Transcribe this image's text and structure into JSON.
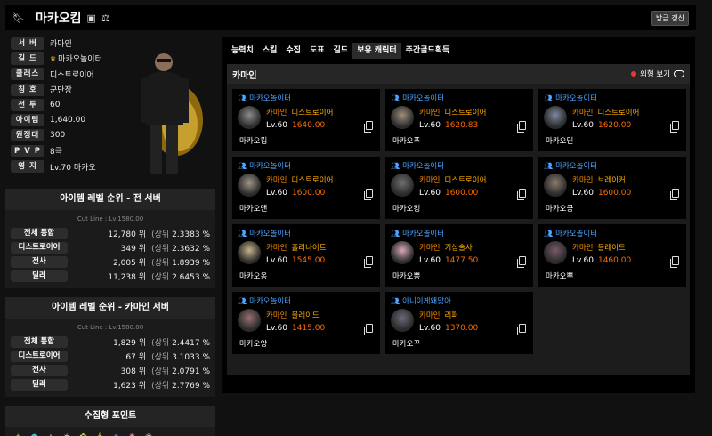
{
  "header": {
    "name": "마카오킴",
    "refresh_label": "방금 갱신"
  },
  "profile": [
    {
      "label": "서 버",
      "value": "카마인"
    },
    {
      "label": "길 드",
      "value": "마카오놀이터",
      "crown": true
    },
    {
      "label": "클래스",
      "value": "디스트로이어"
    },
    {
      "label": "칭 호",
      "value": "군단장"
    },
    {
      "label": "전 투",
      "value": "60"
    },
    {
      "label": "아이템",
      "value": "1,640.00"
    },
    {
      "label": "원정대",
      "value": "300"
    },
    {
      "label": "P V P",
      "value": "8극"
    },
    {
      "label": "영 지",
      "value": "Lv.70 마카오"
    }
  ],
  "rank_all": {
    "title": "아이템 레벨 순위 - 전 서버",
    "cut": "Cut Line : Lv.1580.00",
    "rows": [
      {
        "label": "전체 통합",
        "rank": "12,780 위",
        "pct": "2.3383 %"
      },
      {
        "label": "디스트로이어",
        "rank": "349 위",
        "pct": "2.3632 %"
      },
      {
        "label": "전사",
        "rank": "2,005 위",
        "pct": "1.8939 %"
      },
      {
        "label": "딜러",
        "rank": "11,238 위",
        "pct": "2.6453 %"
      }
    ]
  },
  "rank_server": {
    "title": "아이템 레벨 순위 - 카마인 서버",
    "cut": "Cut Line : Lv.1580.00",
    "rows": [
      {
        "label": "전체 통합",
        "rank": "1,829 위",
        "pct": "2.4417 %"
      },
      {
        "label": "디스트로이어",
        "rank": "67 위",
        "pct": "3.1033 %"
      },
      {
        "label": "전사",
        "rank": "308 위",
        "pct": "2.0791 %"
      },
      {
        "label": "딜러",
        "rank": "1,623 위",
        "pct": "2.7769 %"
      }
    ]
  },
  "upper_label": "(상위",
  "collect_title": "수집형 포인트",
  "tabs": [
    "능력치",
    "스킬",
    "수집",
    "도표",
    "길드",
    "보유 캐릭터",
    "주간골드획득"
  ],
  "active_tab": 5,
  "panel": {
    "title": "카마인",
    "toggle_label": "외형 보기"
  },
  "characters": [
    {
      "guild": "마카오놀이터",
      "server": "카마인",
      "class": "디스트로이어",
      "lv": "Lv.60",
      "ilvl": "1640.00",
      "name": "마카오킴"
    },
    {
      "guild": "마카오놀이터",
      "server": "카마인",
      "class": "디스트로이어",
      "lv": "Lv.60",
      "ilvl": "1620.83",
      "name": "마카오푸"
    },
    {
      "guild": "마카오놀이터",
      "server": "카마인",
      "class": "디스트로이어",
      "lv": "Lv.60",
      "ilvl": "1620.00",
      "name": "마카오딘"
    },
    {
      "guild": "마카오놀이터",
      "server": "카마인",
      "class": "디스트로이어",
      "lv": "Lv.60",
      "ilvl": "1600.00",
      "name": "마카오맨"
    },
    {
      "guild": "마카오놀이터",
      "server": "카마인",
      "class": "디스트로이어",
      "lv": "Lv.60",
      "ilvl": "1600.00",
      "name": "마카오킹"
    },
    {
      "guild": "마카오놀이터",
      "server": "카마인",
      "class": "브레이커",
      "lv": "Lv.60",
      "ilvl": "1600.00",
      "name": "마카오쿵"
    },
    {
      "guild": "마카오놀이터",
      "server": "카마인",
      "class": "홀리나이트",
      "lv": "Lv.60",
      "ilvl": "1545.00",
      "name": "마카오옹"
    },
    {
      "guild": "마카오놀이터",
      "server": "카마인",
      "class": "기상술사",
      "lv": "Lv.60",
      "ilvl": "1477.50",
      "name": "마카오뽕"
    },
    {
      "guild": "마카오놀이터",
      "server": "카마인",
      "class": "블레이드",
      "lv": "Lv.60",
      "ilvl": "1460.00",
      "name": "마카오뿌"
    },
    {
      "guild": "마카오놀이터",
      "server": "카마인",
      "class": "블레이드",
      "lv": "Lv.60",
      "ilvl": "1415.00",
      "name": "마카오앙"
    },
    {
      "guild": "아니이게왜맞아",
      "server": "카마인",
      "class": "리퍼",
      "lv": "Lv.60",
      "ilvl": "1370.00",
      "name": "마카오꾸"
    }
  ]
}
